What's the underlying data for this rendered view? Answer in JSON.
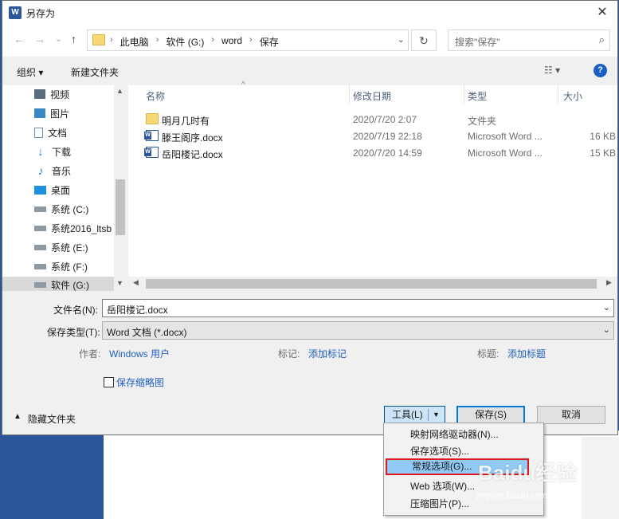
{
  "window": {
    "title": "另存为",
    "close": "✕"
  },
  "nav": {
    "back": "←",
    "forward": "→",
    "recent": "⌄",
    "up": "↑",
    "breadcrumbs": [
      "此电脑",
      "软件 (G:)",
      "word",
      "保存"
    ],
    "refresh": "↻",
    "search_placeholder": "搜索\"保存\""
  },
  "toolbar": {
    "organize": "组织 ▾",
    "new_folder": "新建文件夹",
    "view": "☷ ▾",
    "help": "?"
  },
  "sidebar": {
    "items": [
      {
        "label": "视频",
        "icon": "video-icon"
      },
      {
        "label": "图片",
        "icon": "pictures-icon"
      },
      {
        "label": "文档",
        "icon": "documents-icon"
      },
      {
        "label": "下载",
        "icon": "downloads-icon"
      },
      {
        "label": "音乐",
        "icon": "music-icon"
      },
      {
        "label": "桌面",
        "icon": "desktop-icon"
      },
      {
        "label": "系统 (C:)",
        "icon": "drive-icon"
      },
      {
        "label": "系统2016_ltsb",
        "icon": "drive-icon"
      },
      {
        "label": "系统 (E:)",
        "icon": "drive-icon"
      },
      {
        "label": "系统 (F:)",
        "icon": "drive-icon"
      },
      {
        "label": "软件 (G:)",
        "icon": "drive-icon"
      }
    ],
    "selected": "软件 (G:)"
  },
  "files": {
    "columns": [
      "名称",
      "修改日期",
      "类型",
      "大小"
    ],
    "rows": [
      {
        "name": "明月几时有",
        "date": "2020/7/20 2:07",
        "type": "文件夹",
        "size": "",
        "kind": "folder"
      },
      {
        "name": "滕王阁序.docx",
        "date": "2020/7/19 22:18",
        "type": "Microsoft Word ...",
        "size": "16 KB",
        "kind": "doc"
      },
      {
        "name": "岳阳楼记.docx",
        "date": "2020/7/20 14:59",
        "type": "Microsoft Word ...",
        "size": "15 KB",
        "kind": "doc"
      }
    ]
  },
  "form": {
    "filename_label": "文件名(N):",
    "filename_value": "岳阳楼记.docx",
    "filetype_label": "保存类型(T):",
    "filetype_value": "Word 文档 (*.docx)",
    "author_label": "作者:",
    "author_value": "Windows 用户",
    "tags_label": "标记:",
    "tags_value": "添加标记",
    "title_label": "标题:",
    "title_value": "添加标题",
    "thumbnail_label": "保存缩略图"
  },
  "footer": {
    "hide_folders": "隐藏文件夹",
    "tools": "工具(L)",
    "save": "保存(S)",
    "cancel": "取消"
  },
  "tools_menu": {
    "items": [
      "映射网络驱动器(N)...",
      "保存选项(S)...",
      "常规选项(G)...",
      "Web 选项(W)...",
      "压缩图片(P)..."
    ],
    "highlighted": "常规选项(G)..."
  },
  "watermark": {
    "brand": "Baidu经验",
    "url": "jingyan.baidu.com"
  },
  "colors": {
    "accent": "#0078d7",
    "highlight_border": "#e0161e",
    "link": "#1f5fbf"
  }
}
